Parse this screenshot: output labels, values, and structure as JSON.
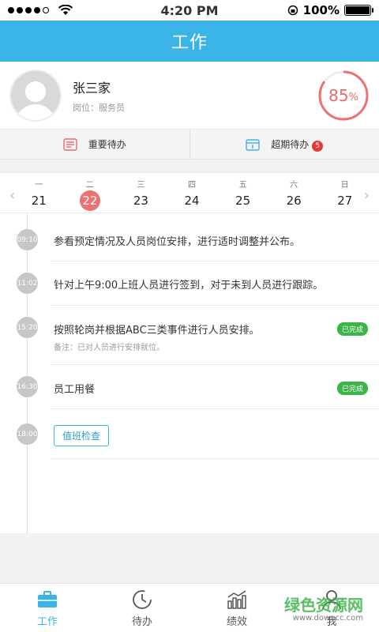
{
  "status": {
    "time": "4:20 PM",
    "battery": "100%",
    "battery_level": 1.0
  },
  "header": {
    "title": "工作"
  },
  "profile": {
    "name": "张三家",
    "role": "岗位：服务员",
    "progress_value": 85,
    "progress_unit": "%"
  },
  "task_tabs": [
    {
      "label": "重要待办",
      "icon": "list-icon"
    },
    {
      "label": "超期待办",
      "icon": "calendar-icon",
      "badge": "5"
    }
  ],
  "week": {
    "days": [
      {
        "name": "一",
        "num": "21"
      },
      {
        "name": "二",
        "num": "22",
        "active": true
      },
      {
        "name": "三",
        "num": "23"
      },
      {
        "name": "四",
        "num": "24"
      },
      {
        "name": "五",
        "num": "25"
      },
      {
        "name": "六",
        "num": "26"
      },
      {
        "name": "日",
        "num": "27"
      }
    ]
  },
  "timeline": [
    {
      "time": "09:10",
      "text": "参看预定情况及人员岗位安排，进行适时调整并公布。"
    },
    {
      "time": "11:02",
      "text": "针对上午9:00上班人员进行签到，对于未到人员进行跟踪。"
    },
    {
      "time": "15:20",
      "text": "按照轮岗并根据ABC三类事件进行人员安排。",
      "note": "备注：已对人员进行安排就位。",
      "status": "已完成"
    },
    {
      "time": "16:30",
      "text": "员工用餐",
      "status": "已完成"
    },
    {
      "time": "18:00",
      "button": "值班检查"
    }
  ],
  "tabbar": [
    {
      "label": "工作",
      "active": true
    },
    {
      "label": "待办"
    },
    {
      "label": "绩效"
    },
    {
      "label": "我"
    }
  ],
  "watermark": {
    "title": "绿色资源网",
    "url": "www.downcc.com"
  },
  "colors": {
    "primary": "#3ab3e6",
    "accent_red": "#ee7070",
    "done_green": "#3bb44a"
  }
}
